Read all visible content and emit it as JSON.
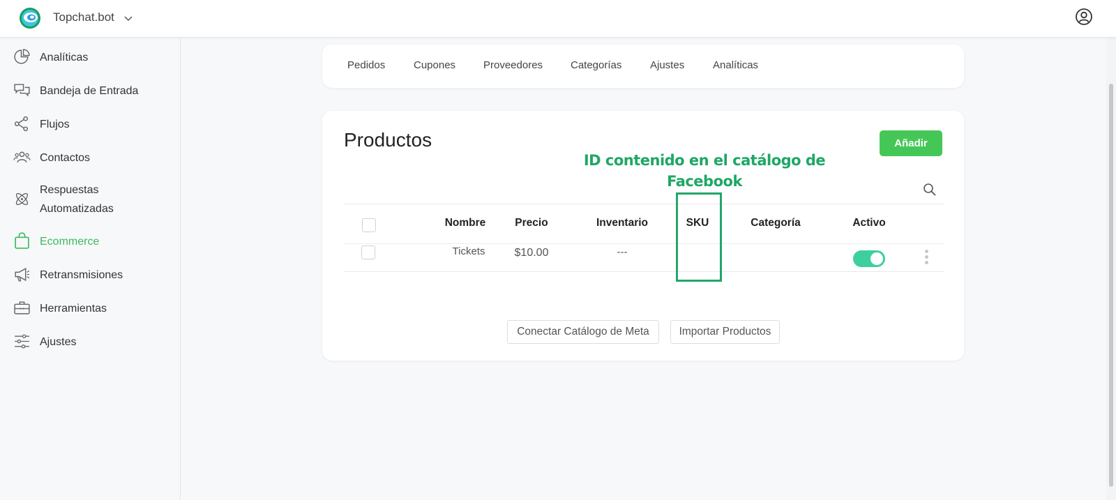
{
  "topbar": {
    "brand": "Topchat.bot",
    "logo_icon": "topchat-logo-icon",
    "user_icon": "user-circle-icon"
  },
  "sidebar": {
    "items": [
      {
        "label": "Analíticas",
        "icon": "pie-chart-icon"
      },
      {
        "label": "Bandeja de Entrada",
        "icon": "chat-bubbles-icon"
      },
      {
        "label": "Flujos",
        "icon": "flow-nodes-icon"
      },
      {
        "label": "Contactos",
        "icon": "contacts-icon"
      },
      {
        "label": "Respuestas",
        "label2": "Automatizadas",
        "icon": "atom-icon"
      },
      {
        "label": "Ecommerce",
        "icon": "shopping-bag-icon",
        "active": true
      },
      {
        "label": "Retransmisiones",
        "icon": "megaphone-icon"
      },
      {
        "label": "Herramientas",
        "icon": "toolbox-icon"
      },
      {
        "label": "Ajustes",
        "icon": "sliders-icon"
      }
    ],
    "active_color": "#3dbb5a"
  },
  "tabs": [
    "Pedidos",
    "Cupones",
    "Proveedores",
    "Categorías",
    "Ajustes",
    "Analíticas"
  ],
  "products": {
    "title": "Productos",
    "add_label": "Añadir",
    "accent": "#45c757",
    "columns": [
      "Nombre",
      "Precio",
      "Inventario",
      "SKU",
      "Categoría",
      "Activo"
    ],
    "rows": [
      {
        "nombre": "Tickets",
        "precio": "$10.00",
        "inventario": "---",
        "sku": "",
        "categoria": "",
        "activo": true
      }
    ],
    "connect_label": "Conectar Catálogo de Meta",
    "import_label": "Importar Productos"
  },
  "annotation": {
    "line1": "ID contenido en el catálogo de",
    "line2": "Facebook",
    "color": "#1ea765"
  }
}
